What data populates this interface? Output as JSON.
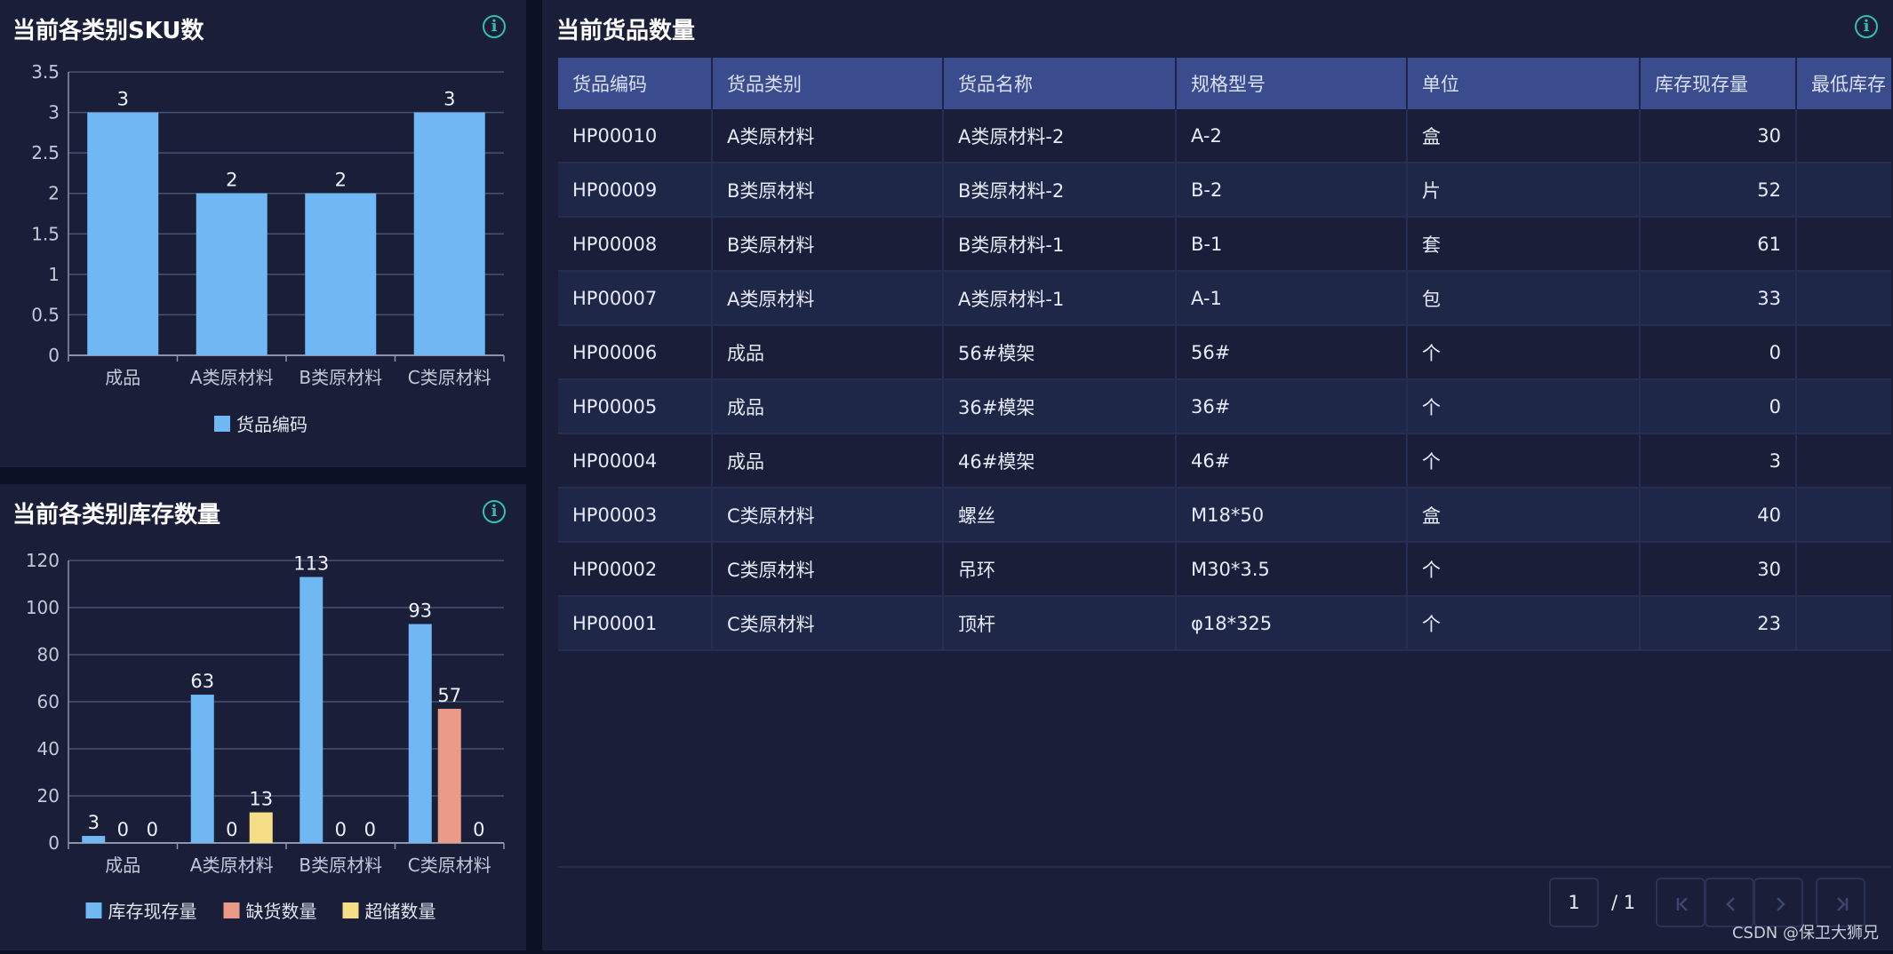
{
  "sku_panel": {
    "title": "当前各类别SKU数",
    "info_icon": "info-circle-icon"
  },
  "stock_panel": {
    "title": "当前各类别库存数量",
    "info_icon": "info-circle-icon"
  },
  "goods_panel": {
    "title": "当前货品数量",
    "info_icon": "info-circle-icon",
    "columns": [
      "货品编码",
      "货品类别",
      "货品名称",
      "规格型号",
      "单位",
      "库存现存量",
      "最低库存"
    ],
    "rows": [
      [
        "HP00010",
        "A类原材料",
        "A类原材料-2",
        "A-2",
        "盒",
        "30",
        ""
      ],
      [
        "HP00009",
        "B类原材料",
        "B类原材料-2",
        "B-2",
        "片",
        "52",
        ""
      ],
      [
        "HP00008",
        "B类原材料",
        "B类原材料-1",
        "B-1",
        "套",
        "61",
        ""
      ],
      [
        "HP00007",
        "A类原材料",
        "A类原材料-1",
        "A-1",
        "包",
        "33",
        ""
      ],
      [
        "HP00006",
        "成品",
        "56#模架",
        "56#",
        "个",
        "0",
        ""
      ],
      [
        "HP00005",
        "成品",
        "36#模架",
        "36#",
        "个",
        "0",
        ""
      ],
      [
        "HP00004",
        "成品",
        "46#模架",
        "46#",
        "个",
        "3",
        ""
      ],
      [
        "HP00003",
        "C类原材料",
        "螺丝",
        "M18*50",
        "盒",
        "40",
        ""
      ],
      [
        "HP00002",
        "C类原材料",
        "吊环",
        "M30*3.5",
        "个",
        "30",
        ""
      ],
      [
        "HP00001",
        "C类原材料",
        "顶杆",
        "φ18*325",
        "个",
        "23",
        ""
      ]
    ],
    "pagination": {
      "current_page": "1",
      "total_label": "/ 1",
      "first_icon": "first-page-icon",
      "prev_icon": "chevron-left-icon",
      "next_icon": "chevron-right-icon",
      "last_icon": "last-page-icon"
    }
  },
  "watermark": "CSDN @保卫大狮兄",
  "colors": {
    "background": "#0d1124",
    "panel": "#1a1e38",
    "header": "#3a4b8e",
    "blue_bar": "#6fb8f4",
    "salmon_bar": "#ec9a88",
    "yellow_bar": "#f5de86",
    "accent_green": "#2fc2a6"
  },
  "chart_data": [
    {
      "type": "bar",
      "title": "当前各类别SKU数",
      "categories": [
        "成品",
        "A类原材料",
        "B类原材料",
        "C类原材料"
      ],
      "series": [
        {
          "name": "货品编码",
          "values": [
            3,
            2,
            2,
            3
          ],
          "color": "#6fb8f4"
        }
      ],
      "ylim": [
        0,
        3.5
      ],
      "yticks": [
        "0",
        "0.5",
        "1",
        "1.5",
        "2",
        "2.5",
        "3",
        "3.5"
      ],
      "grid": true,
      "legend": "bottom",
      "data_labels": true
    },
    {
      "type": "bar",
      "title": "当前各类别库存数量",
      "categories": [
        "成品",
        "A类原材料",
        "B类原材料",
        "C类原材料"
      ],
      "series": [
        {
          "name": "库存现存量",
          "values": [
            3,
            63,
            113,
            93
          ],
          "color": "#6fb8f4"
        },
        {
          "name": "缺货数量",
          "values": [
            0,
            0,
            0,
            57
          ],
          "color": "#ec9a88"
        },
        {
          "name": "超储数量",
          "values": [
            0,
            13,
            0,
            0
          ],
          "color": "#f5de86"
        }
      ],
      "ylim": [
        0,
        120
      ],
      "yticks": [
        "0",
        "20",
        "40",
        "60",
        "80",
        "100",
        "120"
      ],
      "grid": true,
      "legend": "bottom",
      "data_labels": true
    }
  ]
}
